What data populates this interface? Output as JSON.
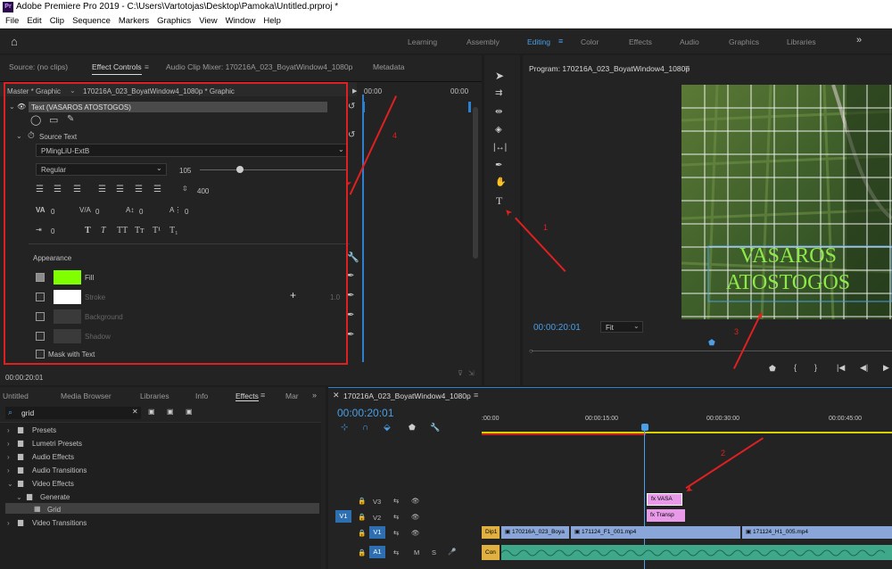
{
  "app": {
    "title": "Adobe Premiere Pro 2019 - C:\\Users\\Vartotojas\\Desktop\\Pamoka\\Untitled.prproj *",
    "icon": "Pr"
  },
  "menu": [
    "File",
    "Edit",
    "Clip",
    "Sequence",
    "Markers",
    "Graphics",
    "View",
    "Window",
    "Help"
  ],
  "workspaces": [
    "Learning",
    "Assembly",
    "Editing",
    "Color",
    "Effects",
    "Audio",
    "Graphics",
    "Libraries"
  ],
  "active_workspace": "Editing",
  "source_tabs": {
    "source": "Source: (no clips)",
    "effect_controls": "Effect Controls",
    "audio_mixer": "Audio Clip Mixer: 170216A_023_BoyatWindow4_1080p",
    "metadata": "Metadata"
  },
  "effect_controls": {
    "master": "Master * Graphic",
    "clip": "170216A_023_BoyatWindow4_1080p * Graphic",
    "time_start": "00:00",
    "time_end": "00:00",
    "text_layer": "Text (VASAROS ATOSTOGOS)",
    "source_text": "Source Text",
    "font": "PMingLiU-ExtB",
    "style": "Regular",
    "size": "105",
    "leading": "400",
    "tracking": "0",
    "kerning": "0",
    "baseline": "0",
    "tsume": "0",
    "indent": "0",
    "appearance": "Appearance",
    "fill": "Fill",
    "stroke": "Stroke",
    "stroke_value": "1.0",
    "background": "Background",
    "shadow": "Shadow",
    "mask": "Mask with Text",
    "fill_color": "#7fff00",
    "timecode": "00:00:20:01",
    "format_buttons": [
      "T",
      "T",
      "TT",
      "Tт",
      "T¹",
      "T₁"
    ]
  },
  "tools": [
    "selection-tool",
    "track-select-tool",
    "ripple-edit-tool",
    "razor-tool",
    "slip-tool",
    "pen-tool",
    "hand-tool",
    "type-tool"
  ],
  "program": {
    "title": "Program: 170216A_023_BoyatWindow4_1080p",
    "timecode": "00:00:20:01",
    "fit": "Fit",
    "overlay_text_1": "VASAROS",
    "overlay_text_2": "ATOSTOGOS",
    "overlay_color": "#8ee84a"
  },
  "project_tabs": {
    "untitled": "Untitled",
    "media_browser": "Media Browser",
    "libraries": "Libraries",
    "info": "Info",
    "effects": "Effects",
    "markers": "Mar"
  },
  "effects": {
    "search": "grid",
    "items": [
      "Presets",
      "Lumetri Presets",
      "Audio Effects",
      "Audio Transitions",
      "Video Effects",
      "Generate",
      "Grid",
      "Video Transitions"
    ]
  },
  "timeline": {
    "tab": "170216A_023_BoyatWindow4_1080p",
    "timecode": "00:00:20:01",
    "ruler": [
      ":00:00",
      "00:00:15:00",
      "00:00:30:00",
      "00:00:45:00"
    ],
    "tracks": [
      "V3",
      "V2",
      "V1",
      "A1"
    ],
    "src_v": "V1",
    "src_a": "A1",
    "clips": {
      "v3": "VASA",
      "v2": "Transp",
      "v1a": "Dip1",
      "v1b": "170216A_023_Boya",
      "v1c": "171124_F1_001.mp4",
      "v1d": "171124_H1_005.mp4",
      "a1": "Con"
    }
  },
  "annotations": [
    "1",
    "2",
    "3",
    "4"
  ],
  "colors": {
    "accent": "#4a9fe8",
    "annotation": "#e02020",
    "clip_pink": "#e89ae8",
    "clip_blue": "#8aa6d8",
    "audio_green": "#3fa88a"
  }
}
